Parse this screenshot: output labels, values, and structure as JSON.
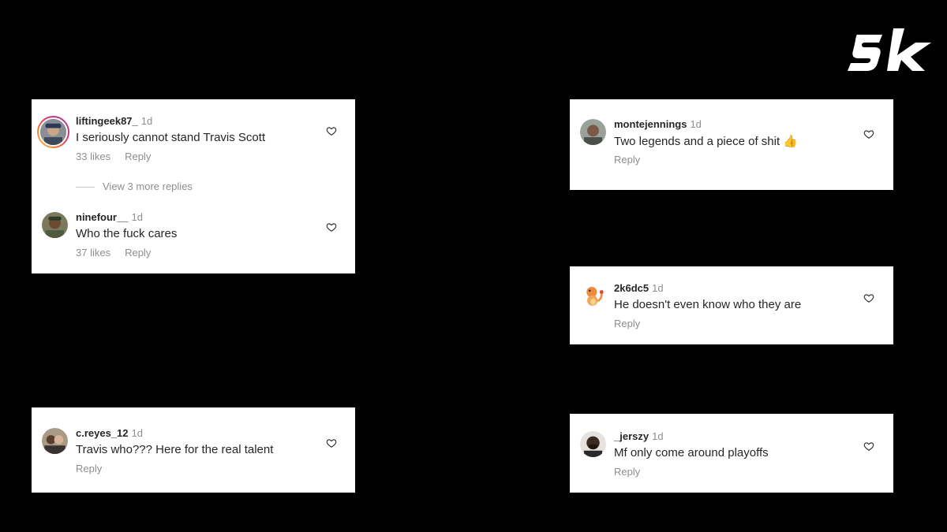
{
  "brand": {
    "logo_text": "sk"
  },
  "cards": [
    {
      "id": "card-1",
      "comments": [
        {
          "username": "liftingeek87_",
          "time": "1d",
          "text": "I seriously cannot stand Travis Scott",
          "likes": "33 likes",
          "reply": "Reply"
        },
        {
          "username": "ninefour__",
          "time": "1d",
          "text": "Who the fuck cares",
          "likes": "37 likes",
          "reply": "Reply"
        }
      ],
      "view_replies": "View 3 more replies"
    },
    {
      "id": "card-2",
      "comments": [
        {
          "username": "c.reyes_12",
          "time": "1d",
          "text": "Travis who??? Here for the real talent",
          "reply": "Reply"
        }
      ]
    },
    {
      "id": "card-3",
      "comments": [
        {
          "username": "montejennings",
          "time": "1d",
          "text": "Two legends and a piece of shit",
          "emoji": "👍",
          "reply": "Reply"
        }
      ]
    },
    {
      "id": "card-4",
      "comments": [
        {
          "username": "2k6dc5",
          "time": "1d",
          "text": "He doesn't even know who they are",
          "reply": "Reply"
        }
      ]
    },
    {
      "id": "card-5",
      "comments": [
        {
          "username": "_jerszy",
          "time": "1d",
          "text": "Mf only come around playoffs",
          "reply": "Reply"
        }
      ]
    }
  ],
  "icons": {
    "like": "heart-outline-icon"
  },
  "colors": {
    "background": "#000000",
    "card": "#ffffff",
    "primary_text": "#262626",
    "secondary_text": "#8e8e8e"
  }
}
